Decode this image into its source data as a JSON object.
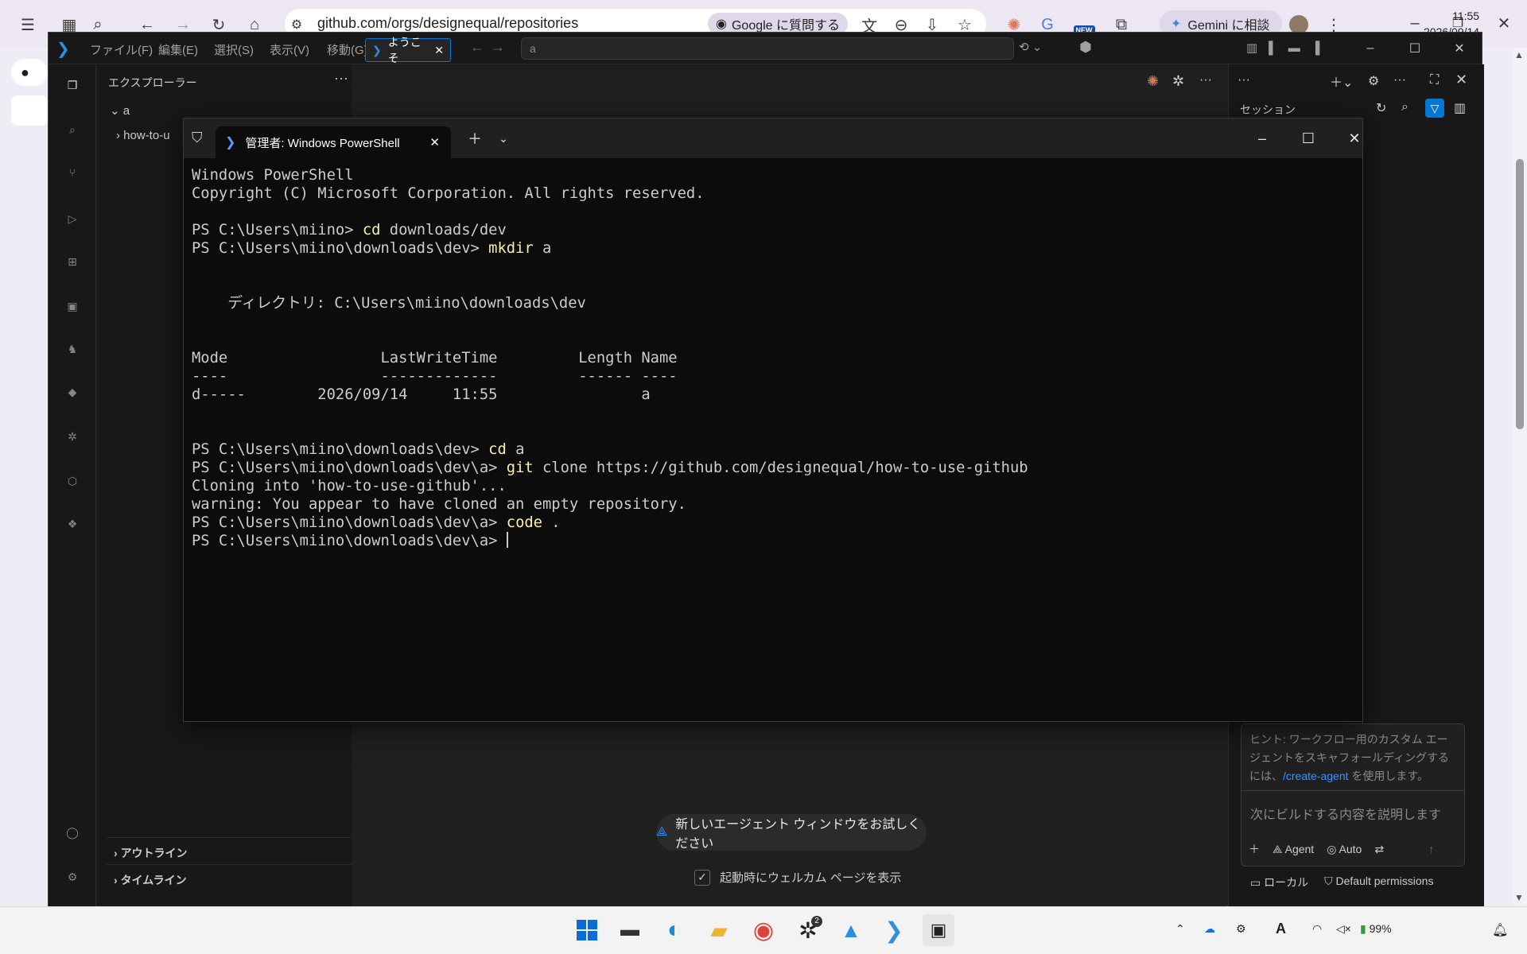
{
  "browser": {
    "url": "github.com/orgs/designequal/repositories",
    "ask_google": "Google に質問する",
    "gemini": "Gemini に相談",
    "new_badge": "NEW"
  },
  "vscode": {
    "menu": [
      "ファイル(F)",
      "編集(E)",
      "選択(S)",
      "表示(V)",
      "移動(G)",
      "…"
    ],
    "command_center": "a",
    "explorer_title": "エクスプローラー",
    "tree": {
      "root": "a",
      "child": "how-to-u"
    },
    "outline": "アウトライン",
    "timeline": "タイムライン",
    "tab_label": "ようこそ",
    "try_agent": "新しいエージェント ウィンドウをお試しください",
    "startup_label": "起動時にウェルカム ページを表示",
    "chat": {
      "sessions_title": "セッション",
      "hint_prefix": "ヒント: ワークフロー用のカスタム エージェントをスキャフォールディングするには、",
      "hint_link": "/create-agent",
      "hint_suffix": " を使用します。",
      "placeholder": "次にビルドする内容を説明します",
      "agent": "Agent",
      "auto": "Auto",
      "local": "ローカル",
      "permissions": "Default permissions"
    }
  },
  "terminal": {
    "tab_title": "管理者: Windows PowerShell",
    "lines": [
      {
        "p": "",
        "c": "",
        "t": "Windows PowerShell"
      },
      {
        "p": "",
        "c": "",
        "t": "Copyright (C) Microsoft Corporation. All rights reserved."
      },
      {
        "p": "",
        "c": "",
        "t": ""
      },
      {
        "p": "PS C:\\Users\\miino> ",
        "c": "cd",
        "t": " downloads/dev"
      },
      {
        "p": "PS C:\\Users\\miino\\downloads\\dev> ",
        "c": "mkdir",
        "t": " a"
      },
      {
        "p": "",
        "c": "",
        "t": ""
      },
      {
        "p": "",
        "c": "",
        "t": ""
      },
      {
        "p": "",
        "c": "",
        "t": "    ディレクトリ: C:\\Users\\miino\\downloads\\dev"
      },
      {
        "p": "",
        "c": "",
        "t": ""
      },
      {
        "p": "",
        "c": "",
        "t": ""
      },
      {
        "p": "",
        "c": "",
        "t": "Mode                 LastWriteTime         Length Name"
      },
      {
        "p": "",
        "c": "",
        "t": "----                 -------------         ------ ----"
      },
      {
        "p": "",
        "c": "",
        "t": "d-----        2026/09/14     11:55                a"
      },
      {
        "p": "",
        "c": "",
        "t": ""
      },
      {
        "p": "",
        "c": "",
        "t": ""
      },
      {
        "p": "PS C:\\Users\\miino\\downloads\\dev> ",
        "c": "cd",
        "t": " a"
      },
      {
        "p": "PS C:\\Users\\miino\\downloads\\dev\\a> ",
        "c": "git",
        "t": " clone https://github.com/designequal/how-to-use-github"
      },
      {
        "p": "",
        "c": "",
        "t": "Cloning into 'how-to-use-github'..."
      },
      {
        "p": "",
        "c": "",
        "t": "warning: You appear to have cloned an empty repository."
      },
      {
        "p": "PS C:\\Users\\miino\\downloads\\dev\\a> ",
        "c": "code",
        "t": " ."
      },
      {
        "p": "PS C:\\Users\\miino\\downloads\\dev\\a> ",
        "c": "",
        "t": ""
      }
    ]
  },
  "taskbar": {
    "badge_count": "2",
    "battery": "99%",
    "time": "11:55",
    "date": "2026/09/14"
  },
  "colors": {
    "vscode_bg": "#1f1f1f",
    "terminal_bg": "#0c0c0c",
    "command_yellow": "#f9f1a5",
    "accent_blue": "#0078d4",
    "link_blue": "#3794ff"
  }
}
